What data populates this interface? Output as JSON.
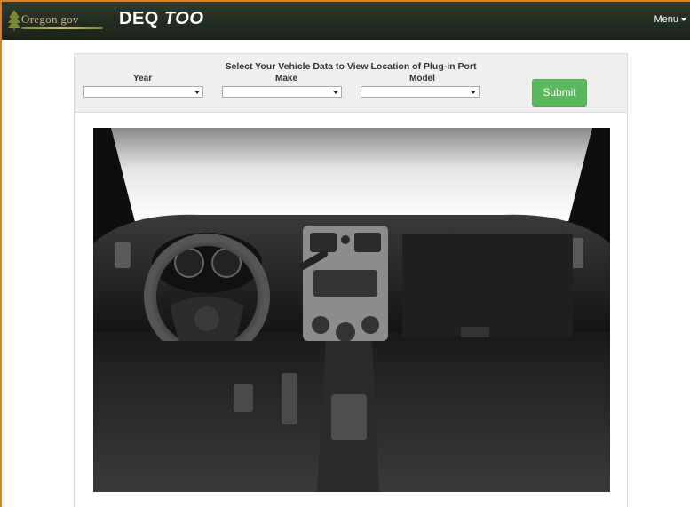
{
  "header": {
    "logo_text": "Oregon.gov",
    "brand_main": "DEQ ",
    "brand_emph": "TOO",
    "menu_label": "Menu"
  },
  "selector": {
    "title": "Select Your Vehicle Data to View Location of Plug-in Port",
    "year_label": "Year",
    "make_label": "Make",
    "model_label": "Model",
    "year_value": "",
    "make_value": "",
    "model_value": "",
    "submit_label": "Submit"
  },
  "colors": {
    "border_accent": "#d9802e",
    "navbar": "#1f271e",
    "submit_green": "#5cb85c"
  }
}
